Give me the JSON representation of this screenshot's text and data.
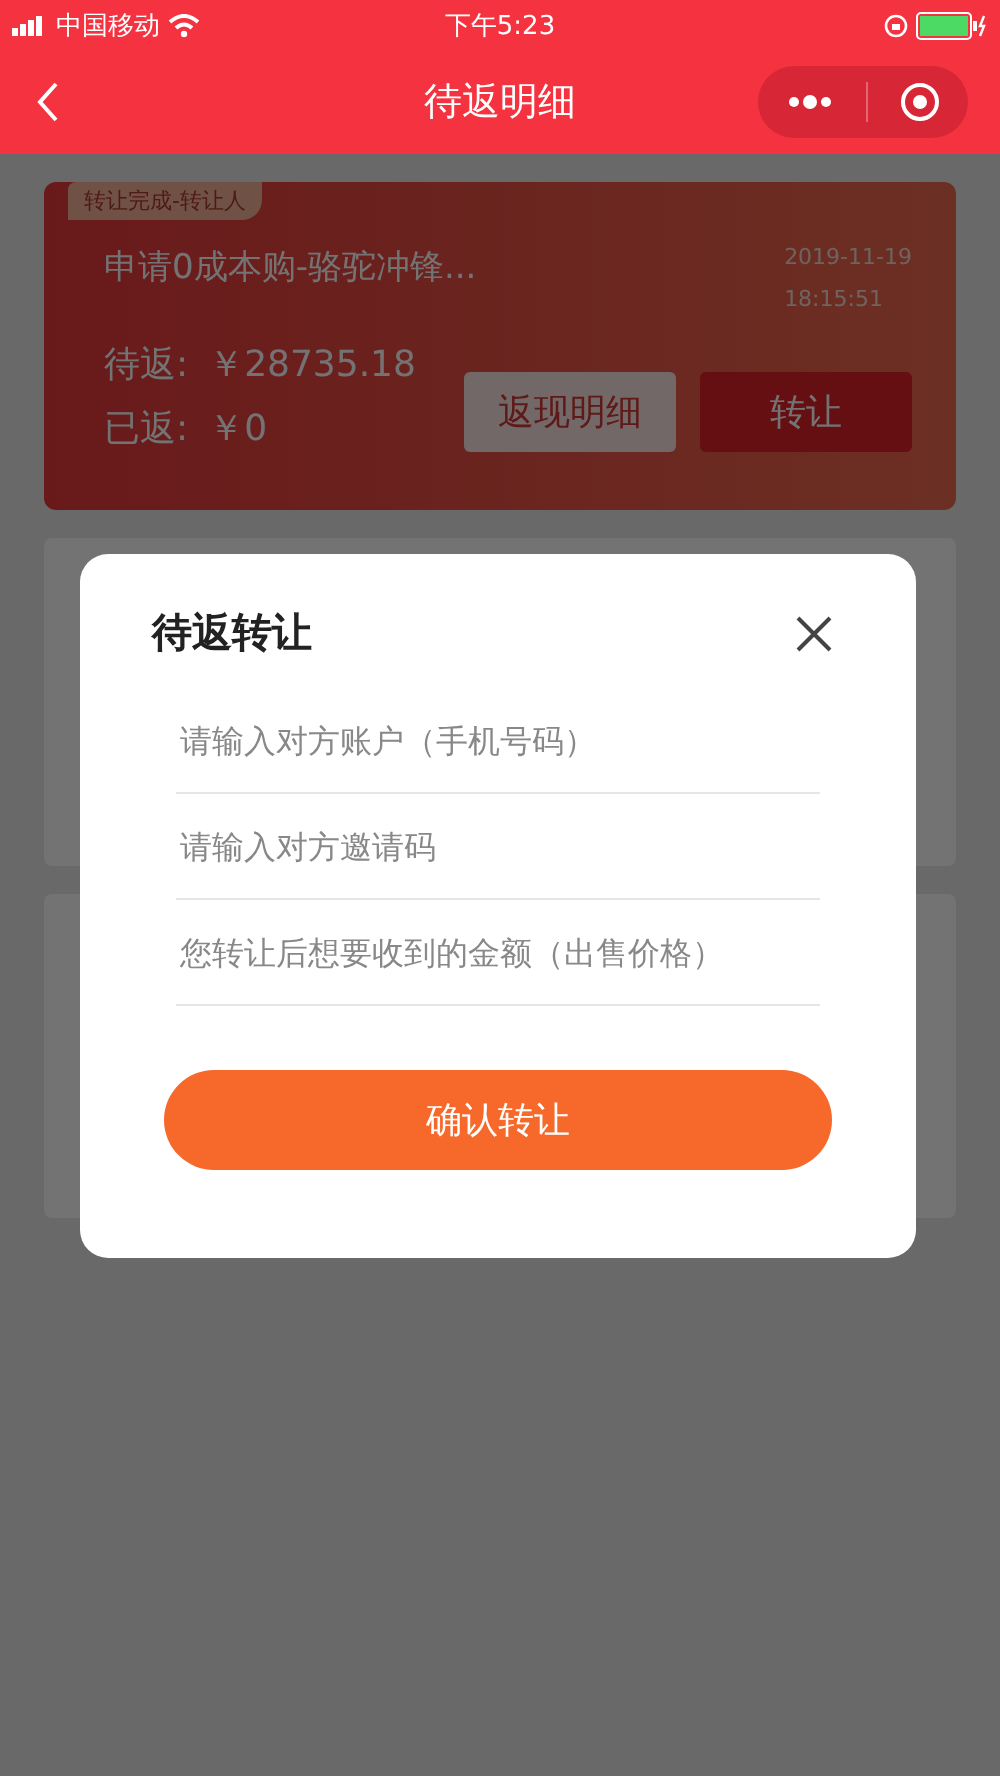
{
  "status_bar": {
    "carrier": "中国移动",
    "time": "下午5:23"
  },
  "nav": {
    "title": "待返明细"
  },
  "card": {
    "tag": "转让完成-转让人",
    "title": "申请0成本购-骆驼冲锋...",
    "date": "2019-11-19",
    "time": "18:15:51",
    "pending_label": "待返:",
    "pending_value": "￥28735.18",
    "returned_label": "已返:",
    "returned_value": "￥0",
    "detail_button": "返现明细",
    "transfer_button": "转让"
  },
  "dialog": {
    "title": "待返转让",
    "fields": [
      {
        "placeholder": "请输入对方账户（手机号码）"
      },
      {
        "placeholder": "请输入对方邀请码"
      },
      {
        "placeholder": "您转让后想要收到的金额（出售价格）"
      }
    ],
    "confirm_button": "确认转让"
  }
}
